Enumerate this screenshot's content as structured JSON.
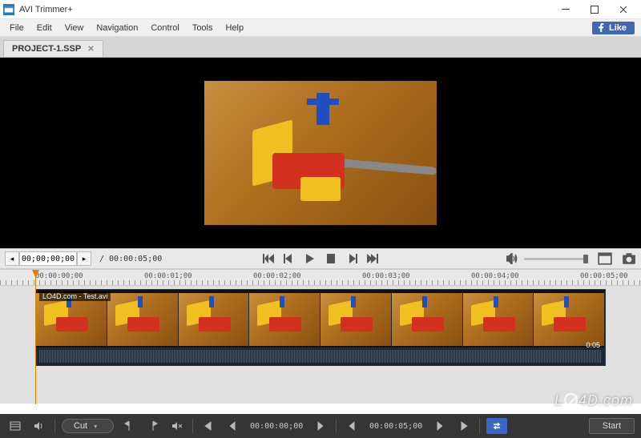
{
  "titlebar": {
    "app_name": "AVI Trimmer+"
  },
  "menu": {
    "items": [
      "File",
      "Edit",
      "View",
      "Navigation",
      "Control",
      "Tools",
      "Help"
    ],
    "fb_like": "Like"
  },
  "tab": {
    "name": "PROJECT-1.SSP"
  },
  "playback": {
    "current_tc": "00;00;00;00",
    "duration_tc": "/ 00:00:05;00"
  },
  "timeline": {
    "ticks": [
      "00:00:00;00",
      "00:00:01;00",
      "00:00:02;00",
      "00:00:03;00",
      "00:00:04;00",
      "00:00:05;00"
    ],
    "clip_label": "LO4D.com - Test.avi",
    "clip_duration": "0:05"
  },
  "bottom": {
    "mode": "Cut",
    "tc_in": "00:00:00;00",
    "tc_out": "00:00:05;00",
    "start_label": "Start"
  },
  "watermark": "LO4D.com"
}
